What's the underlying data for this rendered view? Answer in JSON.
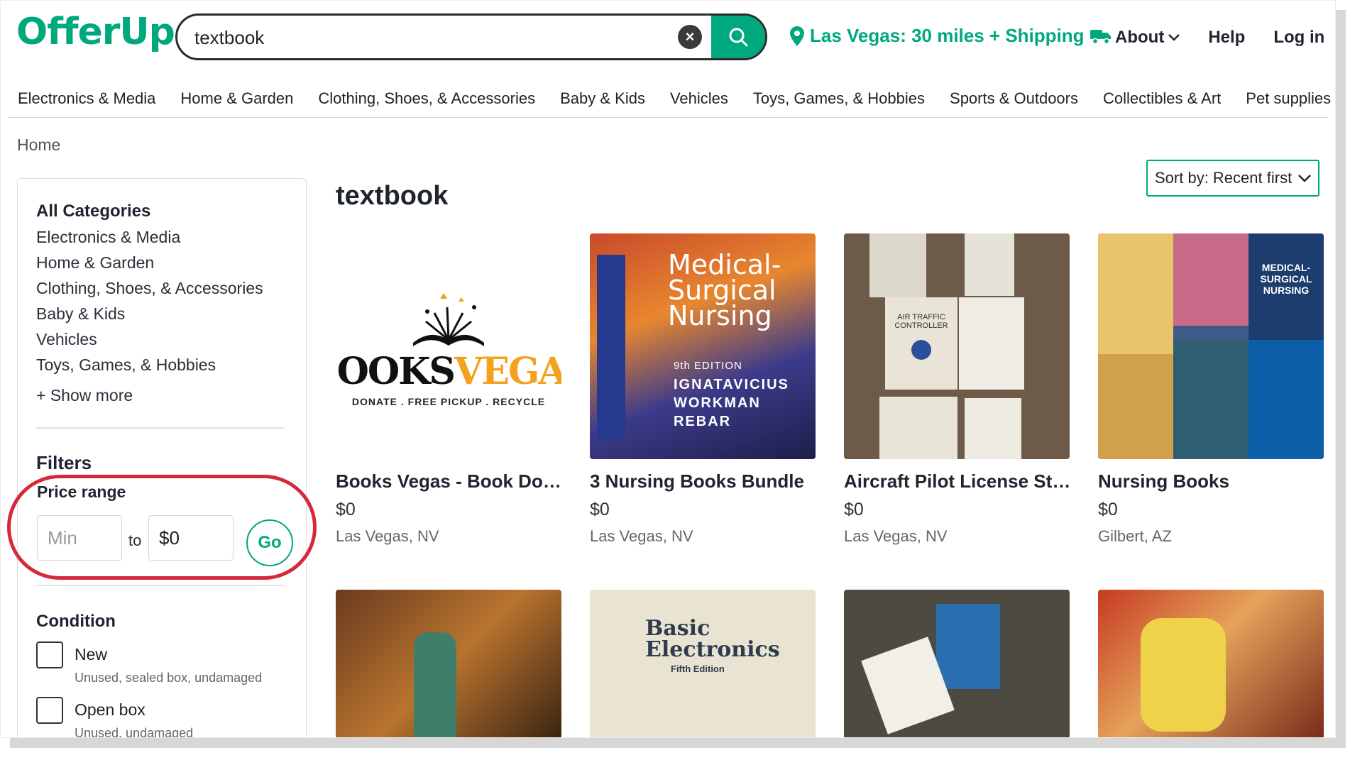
{
  "header": {
    "logo": "OfferUp",
    "search_value": "textbook",
    "location": "Las Vegas: 30 miles + Shipping",
    "links": [
      "About",
      "Help",
      "Log in"
    ]
  },
  "categories": [
    "Electronics & Media",
    "Home & Garden",
    "Clothing, Shoes, & Accessories",
    "Baby & Kids",
    "Vehicles",
    "Toys, Games, & Hobbies",
    "Sports & Outdoors",
    "Collectibles & Art",
    "Pet supplies"
  ],
  "breadcrumb": "Home",
  "sidebar": {
    "all_categories": "All Categories",
    "category_items": [
      "Electronics & Media",
      "Home & Garden",
      "Clothing, Shoes, & Accessories",
      "Baby & Kids",
      "Vehicles",
      "Toys, Games, & Hobbies"
    ],
    "show_more": "+ Show more",
    "filters_title": "Filters",
    "price_range_title": "Price range",
    "price_min_placeholder": "Min",
    "price_to": "to",
    "price_max_value": "$0",
    "go_label": "Go",
    "condition_title": "Condition",
    "conditions": [
      {
        "label": "New",
        "sub": "Unused, sealed box, undamaged"
      },
      {
        "label": "Open box",
        "sub": "Unused, undamaged"
      }
    ]
  },
  "results": {
    "title": "textbook",
    "sort_label": "Sort by: Recent first",
    "listings": [
      {
        "title": "Books Vegas - Book Dona...",
        "price": "$0",
        "location": "Las Vegas, NV",
        "image_text": [
          "BOOKS",
          "VEGAS",
          "DONATE . FREE PICKUP . RECYCLE"
        ]
      },
      {
        "title": "3 Nursing Books Bundle",
        "price": "$0",
        "location": "Las Vegas, NV",
        "image_text": [
          "Medical-",
          "Surgical",
          "Nursing",
          "9th EDITION",
          "IGNATAVICIUS",
          "WORKMAN",
          "REBAR"
        ]
      },
      {
        "title": "Aircraft Pilot License Stu...",
        "price": "$0",
        "location": "Las Vegas, NV",
        "image_text": [
          "AIR TRAFFIC CONTROLLER"
        ]
      },
      {
        "title": "Nursing Books",
        "price": "$0",
        "location": "Gilbert, AZ",
        "image_text": [
          "MEDICAL-SURGICAL NURSING"
        ]
      }
    ],
    "row2_image_text": [
      "Basic Electronics",
      "Fifth Edition"
    ]
  },
  "colors": {
    "brand": "#00a87e",
    "annotation": "#d6283c"
  }
}
